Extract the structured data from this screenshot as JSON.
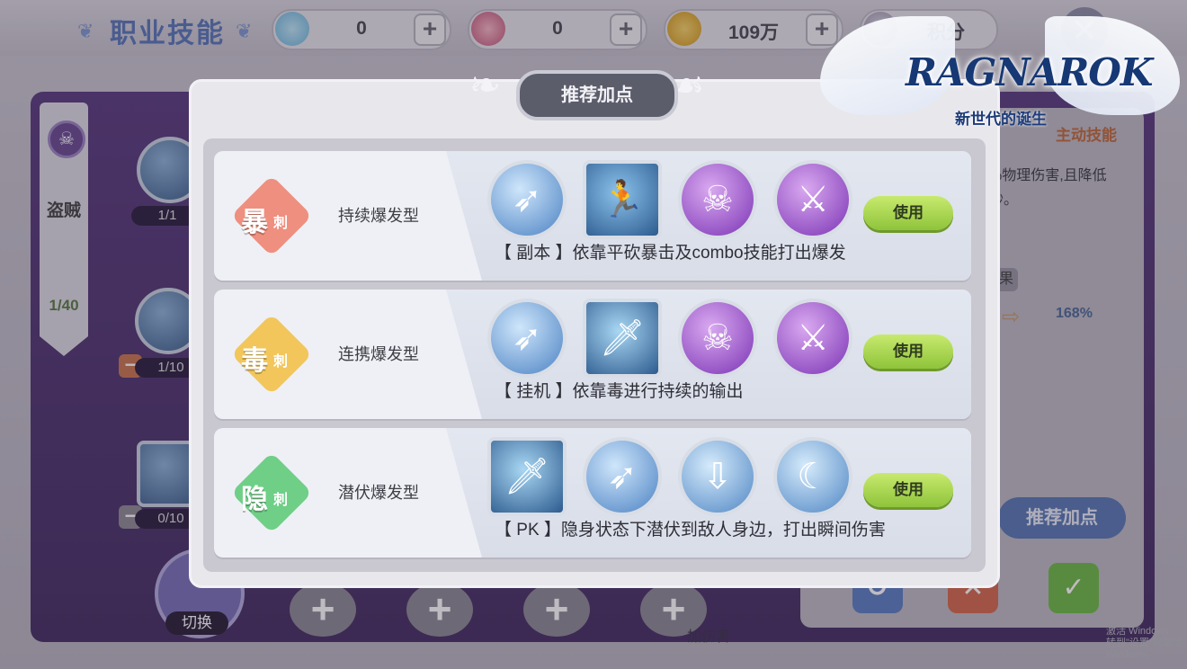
{
  "header": {
    "title": "职业技能",
    "resources": [
      {
        "icon": "diamond-icon",
        "value": "0"
      },
      {
        "icon": "crystal-icon",
        "value": "0"
      },
      {
        "icon": "zeny-coin-icon",
        "value": "109万"
      }
    ],
    "points": {
      "icon": "star-medal-icon",
      "label": "积分"
    }
  },
  "background": {
    "class_name": "盗贼",
    "class_level": "1/40",
    "skill_levels": [
      "1/1",
      "1/10",
      "0/10"
    ],
    "switch_label": "切换",
    "main_skill_label": "主动技能",
    "desc": "%物理伤害,且降低 秒。",
    "effect_label": "果",
    "percent": "168%",
    "recommend_button": "推荐加点",
    "bottom_text": "加伤害"
  },
  "modal": {
    "title": "推荐加点",
    "builds": [
      {
        "badge_big": "暴",
        "badge_small": "刺",
        "badge_color": "#ef8f7f",
        "name": "持续爆发型",
        "skills": [
          "dagger-throw-icon",
          "cloak-run-icon",
          "skull-sword-icon",
          "poison-blade-icon"
        ],
        "use_label": "使用",
        "desc": "【 副本 】依靠平砍暴击及combo技能打出爆发"
      },
      {
        "badge_big": "毒",
        "badge_small": "刺",
        "badge_color": "#f2c65b",
        "name": "连携爆发型",
        "skills": [
          "dagger-throw-icon",
          "blade-slash-icon",
          "skull-sword-icon",
          "poison-blade-icon"
        ],
        "use_label": "使用",
        "desc": "【 挂机 】依靠毒进行持续的输出"
      },
      {
        "badge_big": "隐",
        "badge_small": "刺",
        "badge_color": "#6fcf87",
        "name": "潜伏爆发型",
        "skills": [
          "blade-slash-icon",
          "dagger-throw-icon",
          "spike-trap-icon",
          "hook-blade-icon"
        ],
        "use_label": "使用",
        "desc": "【 PK 】隐身状态下潜伏到敌人身边，打出瞬间伤害"
      }
    ]
  },
  "logo": {
    "text": "RAGNAROK",
    "subtitle": "新世代的诞生"
  },
  "watermark": {
    "line1": "激活 Windows",
    "line2": "转到\"设置\"以激活 Windows。"
  }
}
